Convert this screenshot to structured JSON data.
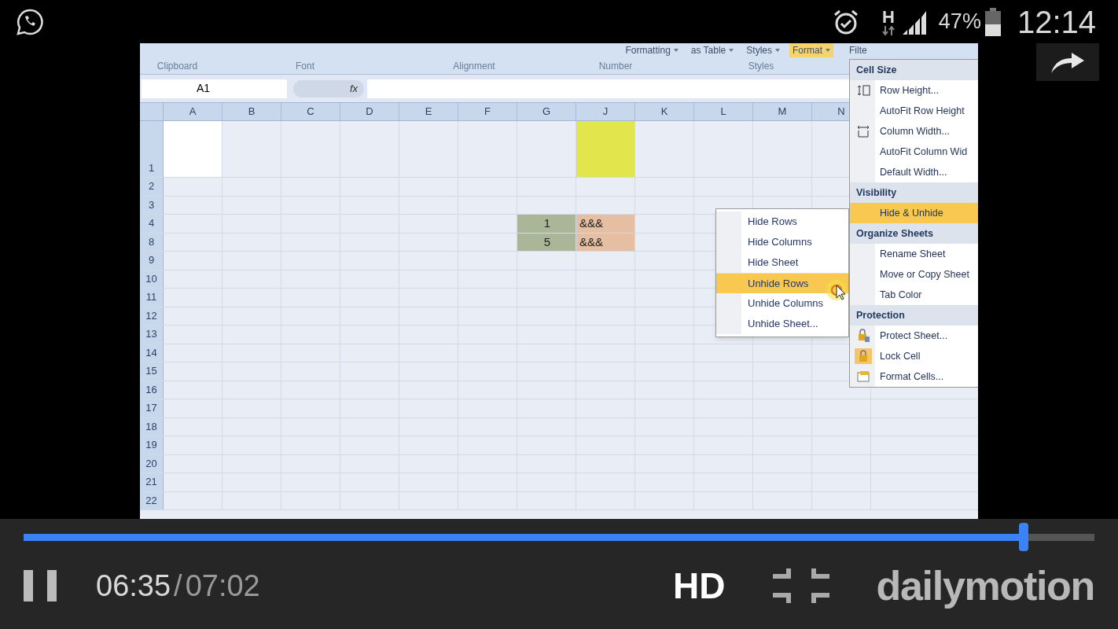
{
  "status_bar": {
    "network": "H",
    "battery": "47%",
    "time": "12:14"
  },
  "ribbon": {
    "top_buttons": [
      "Formatting",
      "as Table",
      "Styles",
      "Format",
      "Filte"
    ],
    "groups": [
      "Clipboard",
      "Font",
      "Alignment",
      "Number",
      "Styles"
    ]
  },
  "formula_bar": {
    "name_box": "A1",
    "fx": "fx"
  },
  "sheet": {
    "columns": [
      "A",
      "B",
      "C",
      "D",
      "E",
      "F",
      "G",
      "J",
      "K",
      "L",
      "M",
      "N"
    ],
    "rows": [
      {
        "number": "1",
        "tall": true,
        "cells": [
          {
            "color": "#ffffff"
          },
          {},
          {},
          {},
          {},
          {},
          {},
          {
            "color": "#e2e54c"
          },
          {},
          {},
          {},
          {}
        ]
      },
      {
        "number": "2",
        "tall": false
      },
      {
        "number": "3",
        "tall": false
      },
      {
        "number": "4",
        "tall": false,
        "cells": [
          {},
          {},
          {},
          {},
          {},
          {},
          {
            "text": "1",
            "color": "#a9b697"
          },
          {
            "text": "&&&",
            "color": "#e6bfa3"
          },
          {},
          {},
          {},
          {}
        ]
      },
      {
        "number": "8",
        "tall": false,
        "cells": [
          {},
          {},
          {},
          {},
          {},
          {},
          {
            "text": "5",
            "color": "#a9b697"
          },
          {
            "text": "&&&",
            "color": "#e6bfa3"
          },
          {},
          {},
          {},
          {}
        ]
      },
      {
        "number": "9",
        "tall": false
      },
      {
        "number": "10",
        "tall": false
      },
      {
        "number": "11",
        "tall": false
      },
      {
        "number": "12",
        "tall": false
      },
      {
        "number": "13",
        "tall": false
      },
      {
        "number": "14",
        "tall": false
      },
      {
        "number": "15",
        "tall": false
      },
      {
        "number": "16",
        "tall": false
      },
      {
        "number": "17",
        "tall": false
      },
      {
        "number": "18",
        "tall": false
      },
      {
        "number": "19",
        "tall": false
      },
      {
        "number": "20",
        "tall": false
      },
      {
        "number": "21",
        "tall": false
      },
      {
        "number": "22",
        "tall": false
      }
    ]
  },
  "format_menu": {
    "sections": [
      {
        "header": "Cell Size",
        "items": [
          {
            "label": "Row Height...",
            "kind": "rowheight",
            "selected": false,
            "checked": false
          },
          {
            "label": "AutoFit Row Height",
            "kind": "plain",
            "selected": false,
            "checked": false
          },
          {
            "label": "Column Width...",
            "kind": "colwidth",
            "selected": false,
            "checked": false
          },
          {
            "label": "AutoFit Column Wid",
            "kind": "plain",
            "selected": false,
            "checked": false
          },
          {
            "label": "Default Width...",
            "kind": "plain",
            "selected": false,
            "checked": false
          }
        ]
      },
      {
        "header": "Visibility",
        "items": [
          {
            "label": "Hide & Unhide",
            "kind": "plain",
            "selected": true,
            "checked": false
          }
        ]
      },
      {
        "header": "Organize Sheets",
        "items": [
          {
            "label": "Rename Sheet",
            "kind": "plain",
            "selected": false,
            "checked": false
          },
          {
            "label": "Move or Copy Sheet",
            "kind": "plain",
            "selected": false,
            "checked": false
          },
          {
            "label": "Tab Color",
            "kind": "plain",
            "selected": false,
            "checked": false
          }
        ]
      },
      {
        "header": "Protection",
        "items": [
          {
            "label": "Protect Sheet...",
            "kind": "protect",
            "selected": false,
            "checked": false
          },
          {
            "label": "Lock Cell",
            "kind": "lock",
            "selected": false,
            "checked": true
          },
          {
            "label": "Format Cells...",
            "kind": "formatcells",
            "selected": false,
            "checked": false
          }
        ]
      }
    ]
  },
  "submenu": {
    "items": [
      {
        "label": "Hide Rows",
        "selected": false
      },
      {
        "label": "Hide Columns",
        "selected": false
      },
      {
        "label": "Hide Sheet",
        "selected": false
      },
      {
        "label": "Unhide Rows",
        "selected": true
      },
      {
        "label": "Unhide Columns",
        "selected": false
      },
      {
        "label": "Unhide Sheet...",
        "selected": false
      }
    ]
  },
  "player": {
    "progress": {
      "level": 0.934
    },
    "elapsed": "06:35",
    "separator": "/",
    "duration": "07:02",
    "quality": "HD",
    "brand": "dailymotion"
  }
}
